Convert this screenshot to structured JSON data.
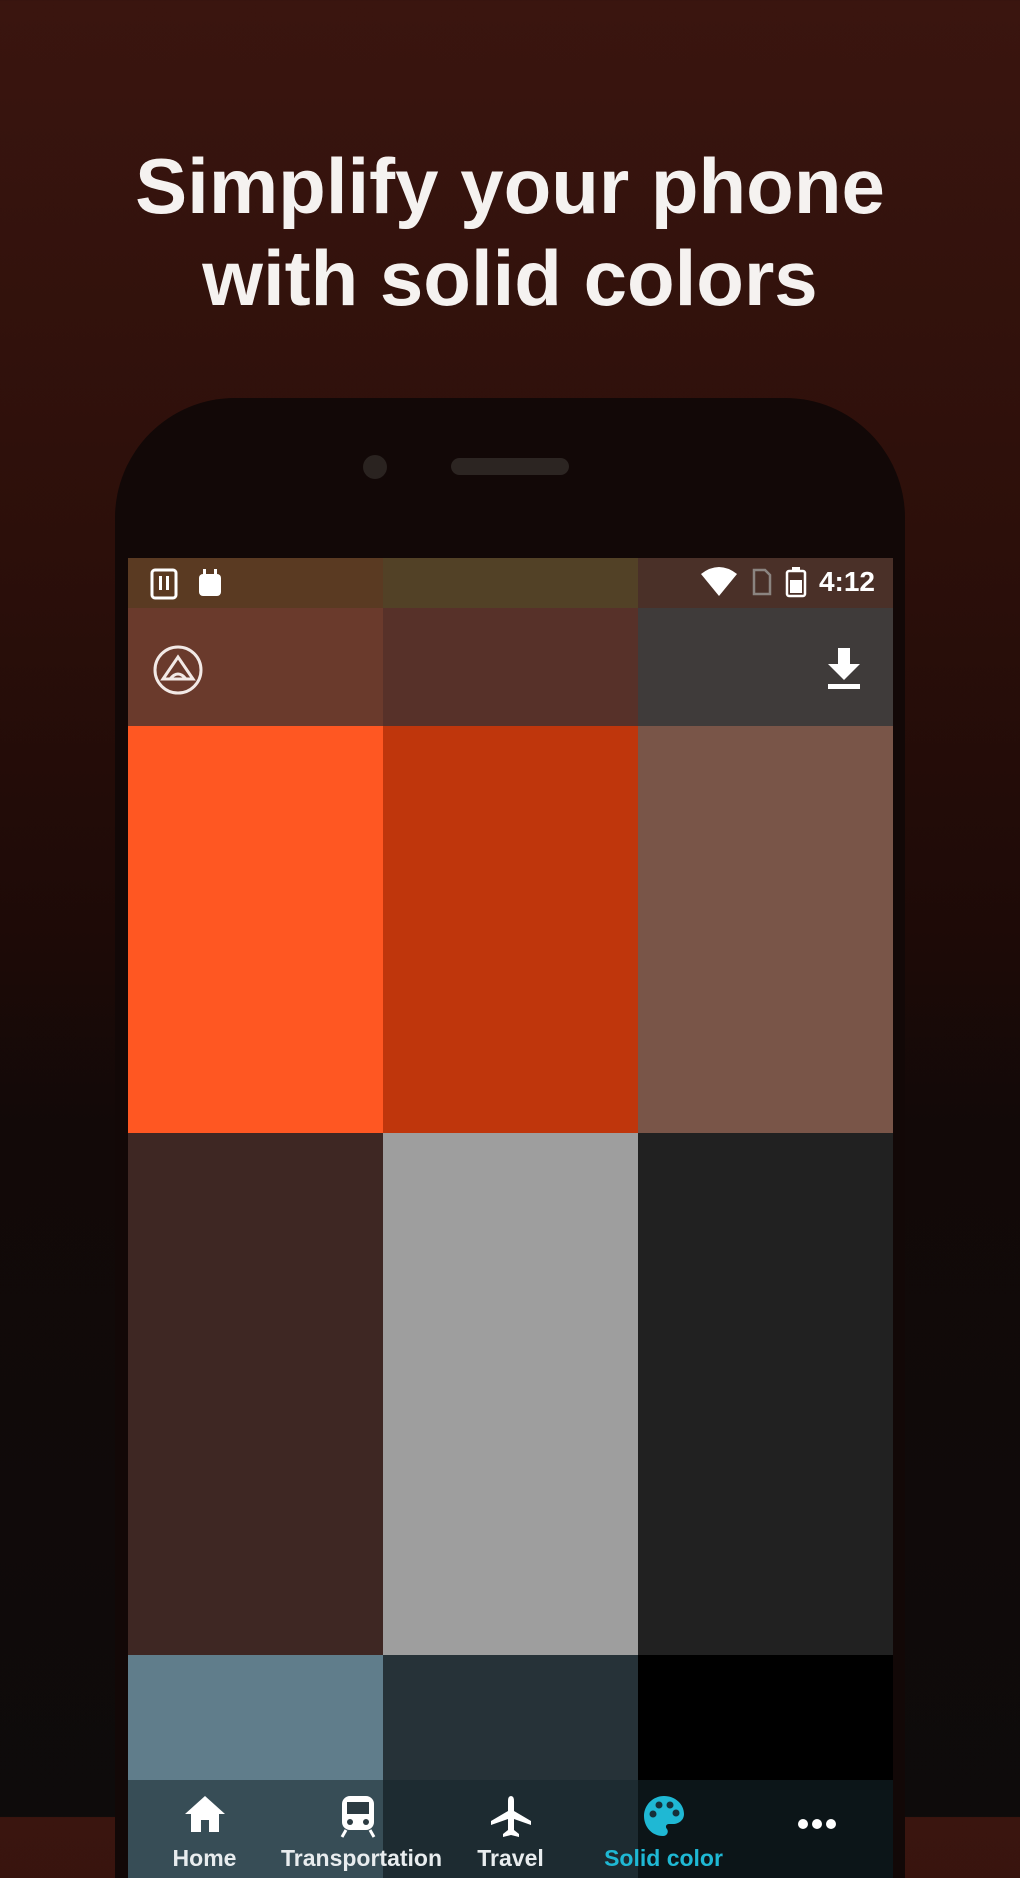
{
  "headline": {
    "line1": "Simplify your phone",
    "line2": "with solid colors"
  },
  "status_bar": {
    "time": "4:12",
    "left_icons": [
      "notification-icon",
      "android-icon"
    ],
    "right_icons": [
      "wifi-icon",
      "sim-icon",
      "battery-icon"
    ]
  },
  "toolbar": {
    "logo": "app-logo-icon",
    "action": "download-icon"
  },
  "palette": {
    "columns": [
      {
        "status": "#5a3a22",
        "toolbar": "#6a3a2c",
        "swatches": [
          "#ff5722",
          "#3e2723",
          "#607d8b"
        ]
      },
      {
        "status": "#524126",
        "toolbar": "#573129",
        "swatches": [
          "#bf360c",
          "#9e9e9e",
          "#263238"
        ]
      },
      {
        "status": "#4a3028",
        "toolbar": "#3f3b3a",
        "swatches": [
          "#795548",
          "#212121",
          "#000000"
        ]
      }
    ]
  },
  "bottom_nav": {
    "items": [
      {
        "label": "Home",
        "icon": "home-icon",
        "active": false
      },
      {
        "label": "Transportation",
        "icon": "train-icon",
        "active": false
      },
      {
        "label": "Travel",
        "icon": "airplane-icon",
        "active": false
      },
      {
        "label": "Solid color",
        "icon": "palette-icon",
        "active": true
      },
      {
        "label": "",
        "icon": "more-icon",
        "active": false
      }
    ],
    "active_color": "#1fb8d4"
  }
}
